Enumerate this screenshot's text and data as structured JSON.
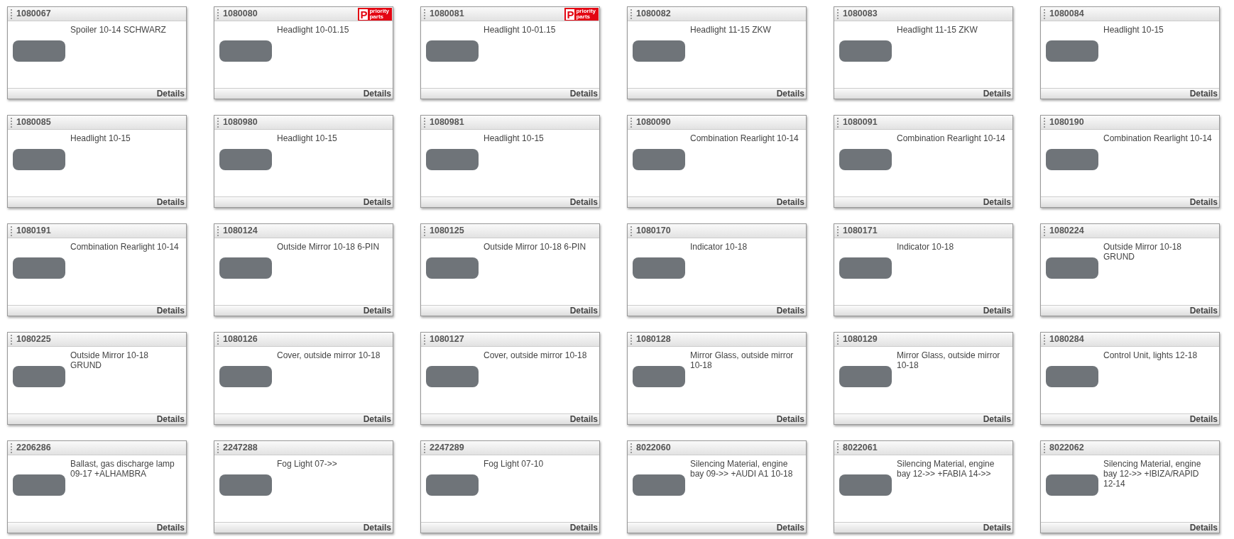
{
  "products": [
    {
      "number": "1080067",
      "description": "Spoiler 10-14 SCHWARZ",
      "link": "Details"
    },
    {
      "number": "1080080",
      "description": "Headlight 10-01.15",
      "link": "Details",
      "badge": {
        "letter": "P",
        "text_top": "priority",
        "text_bottom": "parts"
      }
    },
    {
      "number": "1080081",
      "description": "Headlight 10-01.15",
      "link": "Details",
      "badge": {
        "letter": "P",
        "text_top": "priority",
        "text_bottom": "parts"
      }
    },
    {
      "number": "1080082",
      "description": "Headlight 11-15 ZKW",
      "link": "Details"
    },
    {
      "number": "1080083",
      "description": "Headlight 11-15 ZKW",
      "link": "Details"
    },
    {
      "number": "1080084",
      "description": "Headlight 10-15",
      "link": "Details"
    },
    {
      "number": "1080085",
      "description": "Headlight 10-15",
      "link": "Details"
    },
    {
      "number": "1080980",
      "description": "Headlight 10-15",
      "link": "Details"
    },
    {
      "number": "1080981",
      "description": "Headlight 10-15",
      "link": "Details"
    },
    {
      "number": "1080090",
      "description": "Combination Rearlight 10-14",
      "link": "Details"
    },
    {
      "number": "1080091",
      "description": "Combination Rearlight 10-14",
      "link": "Details"
    },
    {
      "number": "1080190",
      "description": "Combination Rearlight 10-14",
      "link": "Details"
    },
    {
      "number": "1080191",
      "description": "Combination Rearlight 10-14",
      "link": "Details"
    },
    {
      "number": "1080124",
      "description": "Outside Mirror 10-18 6-PIN",
      "link": "Details"
    },
    {
      "number": "1080125",
      "description": "Outside Mirror 10-18 6-PIN",
      "link": "Details"
    },
    {
      "number": "1080170",
      "description": "Indicator 10-18",
      "link": "Details"
    },
    {
      "number": "1080171",
      "description": "Indicator 10-18",
      "link": "Details"
    },
    {
      "number": "1080224",
      "description": "Outside Mirror 10-18 GRUND",
      "link": "Details"
    },
    {
      "number": "1080225",
      "description": "Outside Mirror 10-18 GRUND",
      "link": "Details"
    },
    {
      "number": "1080126",
      "description": "Cover, outside mirror 10-18",
      "link": "Details"
    },
    {
      "number": "1080127",
      "description": "Cover, outside mirror 10-18",
      "link": "Details"
    },
    {
      "number": "1080128",
      "description": "Mirror Glass, outside mirror 10-18",
      "link": "Details"
    },
    {
      "number": "1080129",
      "description": "Mirror Glass, outside mirror 10-18",
      "link": "Details"
    },
    {
      "number": "1080284",
      "description": "Control Unit, lights 12-18",
      "link": "Details"
    },
    {
      "number": "2206286",
      "description": "Ballast, gas discharge lamp 09-17 +ALHAMBRA",
      "link": "Details"
    },
    {
      "number": "2247288",
      "description": "Fog Light 07->>",
      "link": "Details"
    },
    {
      "number": "2247289",
      "description": "Fog Light 07-10",
      "link": "Details"
    },
    {
      "number": "8022060",
      "description": "Silencing Material, engine bay 09->> +AUDI A1 10-18",
      "link": "Details"
    },
    {
      "number": "8022061",
      "description": "Silencing Material, engine bay 12->> +FABIA 14->>",
      "link": "Details"
    },
    {
      "number": "8022062",
      "description": "Silencing Material, engine bay 12->> +IBIZA/RAPID 12-14",
      "link": "Details"
    }
  ]
}
